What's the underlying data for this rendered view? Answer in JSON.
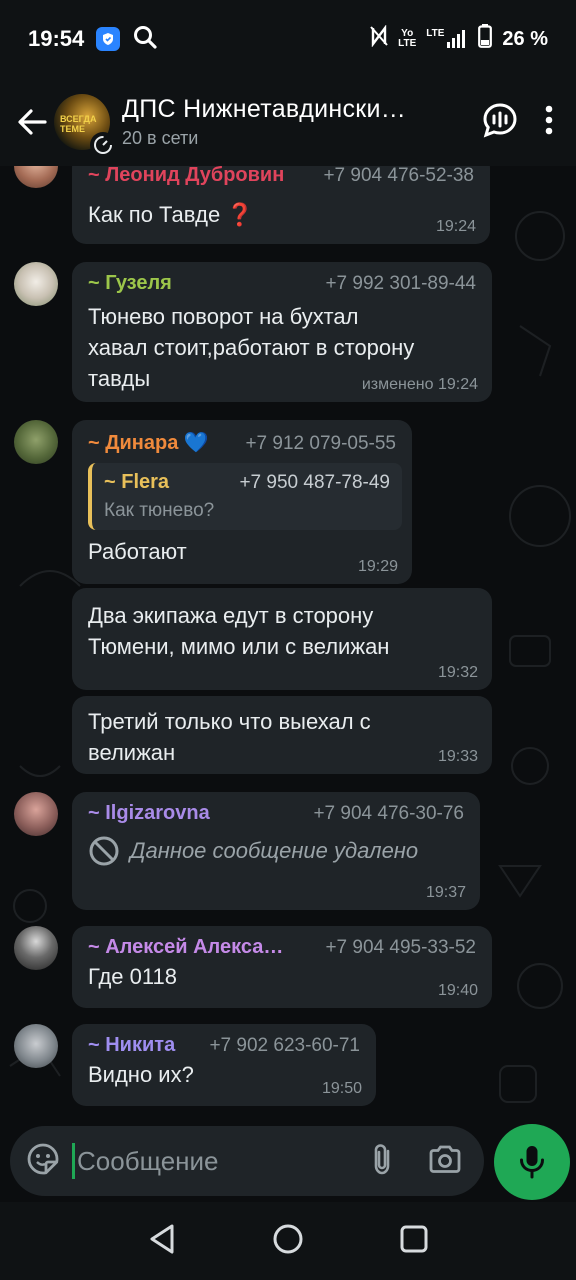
{
  "status_bar": {
    "time": "19:54",
    "battery": "26 %",
    "network_top": "Yo",
    "network_bottom": "LTE",
    "lte_label": "LTE"
  },
  "header": {
    "title": "ДПС Нижнетавдински…",
    "subtitle": "20 в сети",
    "avatar_text_line1": "ВСЕГДА",
    "avatar_text_line2": "ТЕМЕ"
  },
  "messages": [
    {
      "sender": "~ Леонид Дубровин",
      "phone": "+7 904 476-52-38",
      "text": "Как по Тавде ❓",
      "time": "19:24",
      "sender_color": "#e0445c"
    },
    {
      "sender": "~ Гузеля",
      "phone": "+7 992 301-89-44",
      "text_lines": [
        "Тюнево поворот на бухтал",
        "хавал стоит,работают в сторону",
        "тавды"
      ],
      "edited": "изменено",
      "time": "19:24",
      "sender_color": "#9cc64a"
    },
    {
      "sender": "~ Динара 💙",
      "phone": "+7 912 079-05-55",
      "quote_name": "~ Flera",
      "quote_phone": "+7 950 487-78-49",
      "quote_text": "Как тюнево?",
      "text": "Работают",
      "time": "19:29",
      "sender_color": "#f08a3c"
    },
    {
      "text_lines": [
        "Два экипажа едут в сторону",
        "Тюмени, мимо или с велижан"
      ],
      "time": "19:32"
    },
    {
      "text_lines": [
        "Третий только что выехал с",
        "велижан"
      ],
      "time": "19:33"
    },
    {
      "sender": "~ Ilgizarovna",
      "phone": "+7 904 476-30-76",
      "deleted_text": "Данное сообщение удалено",
      "time": "19:37",
      "sender_color": "#a98be8"
    },
    {
      "sender": "~ Алексей Алекса…",
      "phone": "+7 904 495-33-52",
      "text": "Где 0118",
      "time": "19:40",
      "sender_color": "#c58ae8"
    },
    {
      "sender": "~ Никита",
      "phone": "+7 902 623-60-71",
      "text": "Видно их?",
      "time": "19:50",
      "sender_color": "#9f8ef0"
    }
  ],
  "input": {
    "placeholder": "Сообщение"
  },
  "colors": {
    "accent": "#1fa855",
    "bubble": "#1f2428",
    "background": "#0b0d0f"
  }
}
